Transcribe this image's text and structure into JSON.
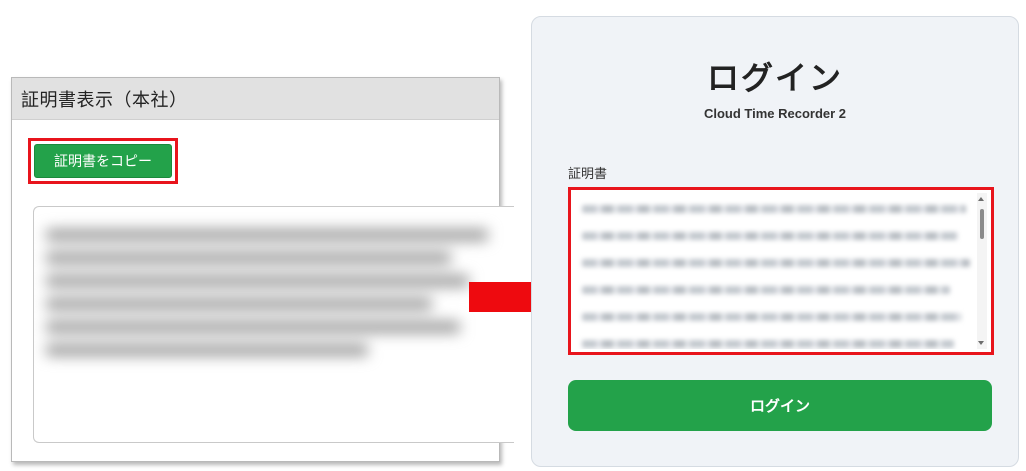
{
  "left_window": {
    "title": "証明書表示（本社）",
    "copy_button_label": "証明書をコピー"
  },
  "right_panel": {
    "heading": "ログイン",
    "app_name": "Cloud Time Recorder 2",
    "certificate_label": "証明書",
    "login_button_label": "ログイン"
  },
  "colors": {
    "accent_green": "#23a24a",
    "highlight_red": "#e8141c",
    "arrow_red": "#ee0a0f"
  }
}
